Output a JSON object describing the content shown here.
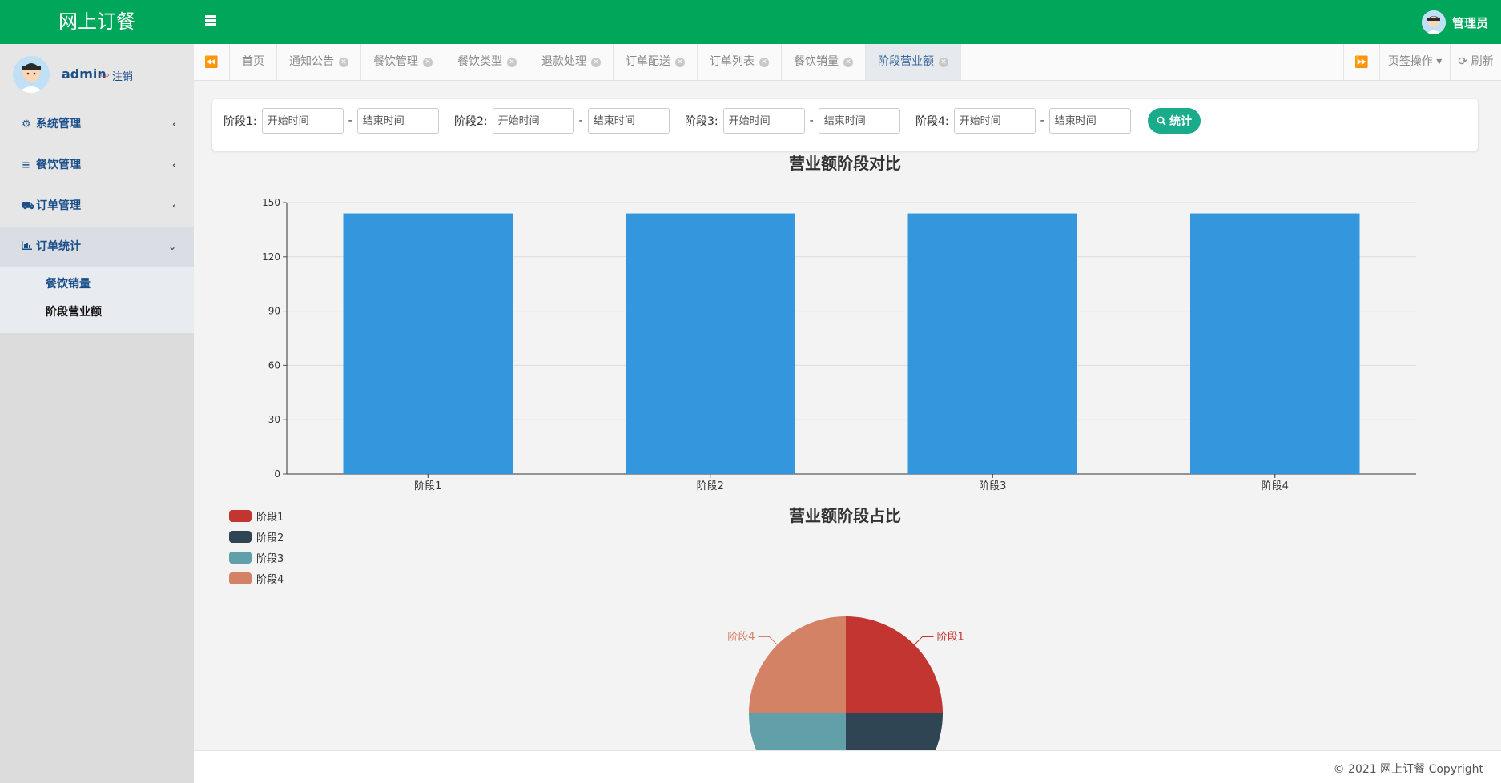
{
  "app": {
    "brand": "网上订餐",
    "user_label": "管理员"
  },
  "sidebar": {
    "username": "admin",
    "logout": "注销",
    "menus": [
      {
        "label": "系统管理",
        "icon": "gear-icon"
      },
      {
        "label": "餐饮管理",
        "icon": "list-icon"
      },
      {
        "label": "订单管理",
        "icon": "cart-icon"
      },
      {
        "label": "订单统计",
        "icon": "bar-chart-icon"
      }
    ],
    "submenu": [
      {
        "label": "餐饮销量"
      },
      {
        "label": "阶段营业额"
      }
    ]
  },
  "tabs": {
    "items": [
      {
        "label": "首页",
        "closable": false
      },
      {
        "label": "通知公告",
        "closable": true
      },
      {
        "label": "餐饮管理",
        "closable": true
      },
      {
        "label": "餐饮类型",
        "closable": true
      },
      {
        "label": "退款处理",
        "closable": true
      },
      {
        "label": "订单配送",
        "closable": true
      },
      {
        "label": "订单列表",
        "closable": true
      },
      {
        "label": "餐饮销量",
        "closable": true
      },
      {
        "label": "阶段营业额",
        "closable": true,
        "active": true
      }
    ],
    "ops_label": "页签操作",
    "refresh_label": "刷新"
  },
  "filter": {
    "stages": [
      {
        "label": "阶段1:",
        "start_placeholder": "开始时间",
        "end_placeholder": "结束时间"
      },
      {
        "label": "阶段2:",
        "start_placeholder": "开始时间",
        "end_placeholder": "结束时间"
      },
      {
        "label": "阶段3:",
        "start_placeholder": "开始时间",
        "end_placeholder": "结束时间"
      },
      {
        "label": "阶段4:",
        "start_placeholder": "开始时间",
        "end_placeholder": "结束时间"
      }
    ],
    "dash": "-",
    "button_label": "统计"
  },
  "chart_data": [
    {
      "type": "bar",
      "title": "营业额阶段对比",
      "categories": [
        "阶段1",
        "阶段2",
        "阶段3",
        "阶段4"
      ],
      "values": [
        144,
        144,
        144,
        144
      ],
      "ylim": [
        0,
        150
      ],
      "yticks": [
        0,
        30,
        60,
        90,
        120,
        150
      ],
      "color": "#3496dc",
      "grid": true
    },
    {
      "type": "pie",
      "title": "营业额阶段占比",
      "labels": [
        "阶段1",
        "阶段2",
        "阶段3",
        "阶段4"
      ],
      "values": [
        25,
        25,
        25,
        25
      ],
      "colors": [
        "#c23531",
        "#2f4554",
        "#61a0a8",
        "#d48265"
      ],
      "legend_position": "top-left"
    }
  ],
  "footer": {
    "text": "© 2021 网上订餐 Copyright"
  }
}
